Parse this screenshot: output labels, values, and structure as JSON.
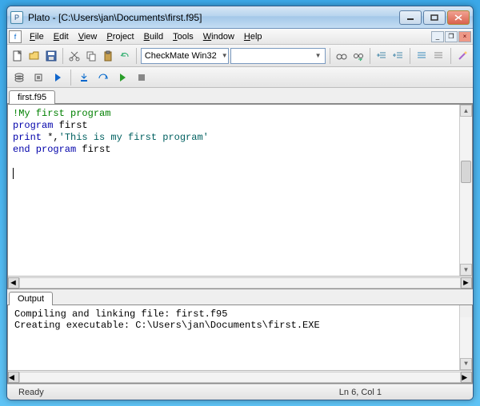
{
  "window": {
    "title": "Plato - [C:\\Users\\jan\\Documents\\first.f95]"
  },
  "menu": {
    "file": "File",
    "edit": "Edit",
    "view": "View",
    "project": "Project",
    "build": "Build",
    "tools": "Tools",
    "window": "Window",
    "help": "Help"
  },
  "toolbar": {
    "combo_config": "CheckMate Win32",
    "combo_config2": ""
  },
  "editor": {
    "tab_label": "first.f95",
    "code": {
      "line1_comment": "!My first program",
      "line2_kw": "program",
      "line2_id": " first",
      "line3_kw": "print",
      "line3_rest": " *,",
      "line3_str": "'This is my first program'",
      "line4_kw": "end program",
      "line4_id": " first"
    }
  },
  "output": {
    "tab_label": "Output",
    "line1": "Compiling and linking file: first.f95",
    "line2": "Creating executable: C:\\Users\\jan\\Documents\\first.EXE"
  },
  "status": {
    "ready": "Ready",
    "pos": "Ln 6, Col 1"
  }
}
